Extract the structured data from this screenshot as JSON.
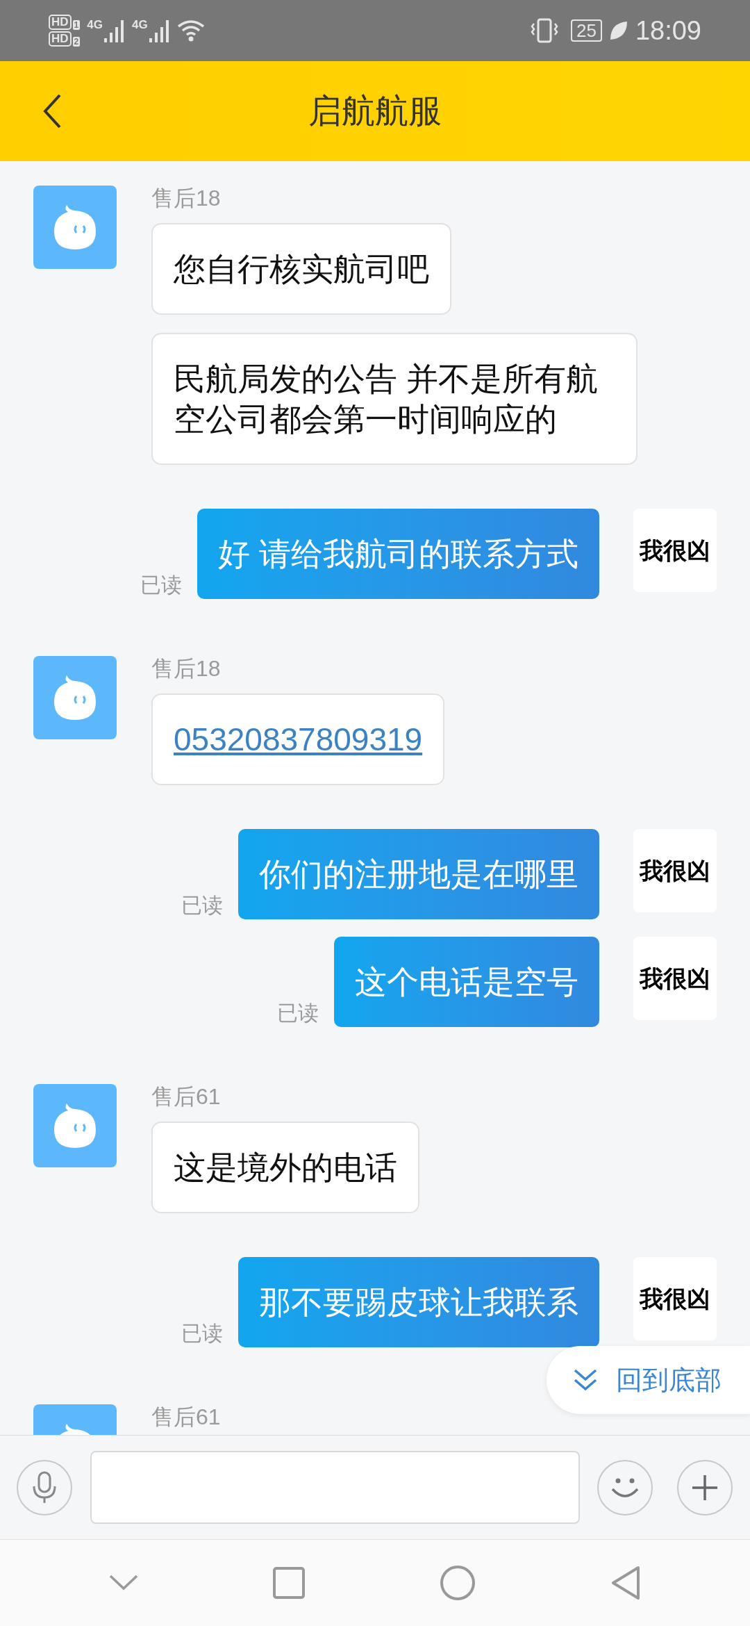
{
  "status_bar": {
    "sims": [
      {
        "label": "HD",
        "slot": "1"
      },
      {
        "label": "HD",
        "slot": "2"
      }
    ],
    "networks": [
      "4G",
      "4G"
    ],
    "battery": "25",
    "time": "18:09"
  },
  "header": {
    "title": "启航航服"
  },
  "messages": [
    {
      "kind": "agent",
      "name": "售后18",
      "bubbles": [
        {
          "kind": "text",
          "text": "您自行核实航司吧"
        },
        {
          "kind": "text",
          "text": "民航局发的公告 并不是所有航空公司都会第一时间响应的"
        }
      ]
    },
    {
      "kind": "user",
      "avatar": "我很凶",
      "text": "好 请给我航司的联系方式",
      "receipt": "已读"
    },
    {
      "kind": "agent",
      "name": "售后18",
      "bubbles": [
        {
          "kind": "link",
          "text": "05320837809319"
        }
      ]
    },
    {
      "kind": "user",
      "avatar": "我很凶",
      "text": "你们的注册地是在哪里",
      "receipt": "已读"
    },
    {
      "kind": "user",
      "avatar": "我很凶",
      "text": "这个电话是空号",
      "receipt": "已读"
    },
    {
      "kind": "agent",
      "name": "售后61",
      "bubbles": [
        {
          "kind": "text",
          "text": "这是境外的电话"
        }
      ]
    },
    {
      "kind": "user",
      "avatar": "我很凶",
      "text": "那不要踢皮球让我联系",
      "receipt": "已读"
    },
    {
      "kind": "agent",
      "name": "售后61"
    }
  ],
  "scroll_to_bottom": {
    "label": "回到底部"
  }
}
